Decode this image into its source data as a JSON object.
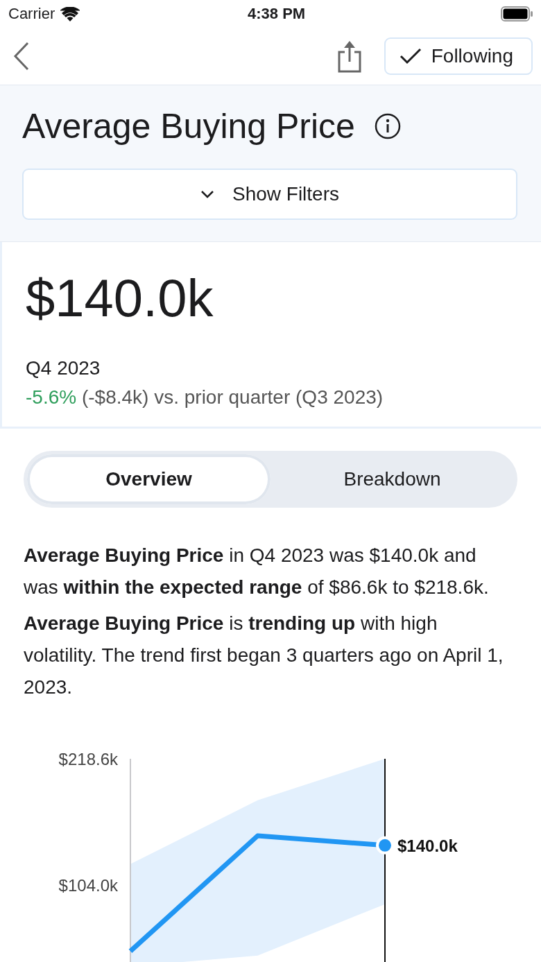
{
  "status_bar": {
    "carrier": "Carrier",
    "time": "4:38 PM"
  },
  "nav": {
    "follow_button": {
      "label": "Following",
      "checked": true
    }
  },
  "header": {
    "title": "Average Buying Price",
    "filters_button": "Show Filters"
  },
  "metric": {
    "value": "$140.0k",
    "period": "Q4 2023",
    "change": "-5.6%",
    "change_detail": "(-$8.4k) vs. prior quarter (Q3 2023)"
  },
  "segments": [
    {
      "label": "Overview",
      "selected": true
    },
    {
      "label": "Breakdown",
      "selected": false
    }
  ],
  "summary": [
    "**Average Buying Price** in Q4 2023 was $140.0k and was **within the expected range** of $86.6k to $218.6k.",
    "**Average Buying Price** is **trending up** with high volatility. The trend first began 3 quarters ago on April 1, 2023."
  ],
  "chart": {
    "chart_data": {
      "type": "line",
      "ylim": [
        30,
        218.6
      ],
      "yticks": [
        {
          "value": 104.0,
          "label": "$104.0k"
        },
        {
          "value": 218.6,
          "label": "$218.6k"
        }
      ],
      "series": [
        {
          "color": "#2196f3",
          "values": [
            44.0,
            148.7,
            140.0
          ]
        }
      ],
      "annotations": [
        "$140.0k"
      ]
    }
  }
}
